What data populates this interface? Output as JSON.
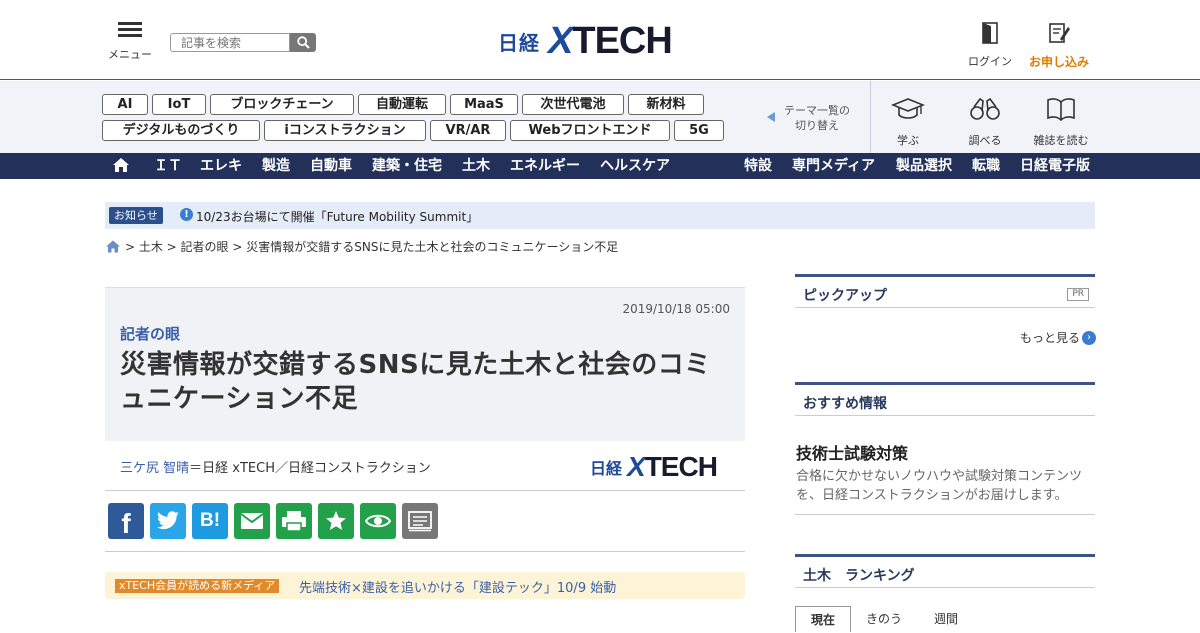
{
  "header": {
    "menu_label": "メニュー",
    "search_placeholder": "記事を検索",
    "logo_nikkei": "日経",
    "logo_xtech_x": "X",
    "logo_xtech_rest": "TECH",
    "login_label": "ログイン",
    "subscribe_label": "お申し込み"
  },
  "themes": {
    "tags": [
      "AI",
      "IoT",
      "ブロックチェーン",
      "自動運転",
      "MaaS",
      "次世代電池",
      "新材料",
      "デジタルものづくり",
      "iコンストラクション",
      "VR/AR",
      "Webフロントエンド",
      "5G"
    ],
    "switch_line1": "テーマ一覧の",
    "switch_line2": "切り替え"
  },
  "tools": {
    "learn": "学ぶ",
    "research": "調べる",
    "read": "雑誌を読む"
  },
  "catnav": {
    "left": [
      "ＩＴ",
      "エレキ",
      "製造",
      "自動車",
      "建築・住宅",
      "土木",
      "エネルギー",
      "ヘルスケア"
    ],
    "right": [
      "特設",
      "専門メディア",
      "製品選択",
      "転職",
      "日経電子版"
    ]
  },
  "notice": {
    "badge": "お知らせ",
    "icon": "!",
    "text": "10/23お台場にて開催「Future Mobility Summit」"
  },
  "breadcrumb": "> 土木 > 記者の眼 > 災害情報が交錯するSNSに見た土木と社会のコミュニケーション不足",
  "article": {
    "date": "2019/10/18 05:00",
    "category": "記者の眼",
    "title": "災害情報が交錯するSNSに見た土木と社会のコミュニケーション不足",
    "author_name": "三ケ尻 智晴",
    "author_dept": "＝日経 xTECH／日経コンストラクション"
  },
  "share": {
    "facebook_letter": "f",
    "hatena_text": "B!",
    "colors": {
      "facebook": "#2f5a9a",
      "twitter": "#2aa5e8",
      "hatena": "#1e9be0",
      "mail": "#22a04a",
      "print": "#22a04a",
      "bookmark": "#22a04a",
      "watch": "#22a04a",
      "memo": "#777777"
    }
  },
  "promo": {
    "badge": "xTECH会員が読める新メディア",
    "text": "先端技術×建設を追いかける「建設テック」10/9 始動"
  },
  "sidebar": {
    "pickup_title": "ピックアップ",
    "pr_label": "PR",
    "more_label": "もっと見る",
    "recommend_title": "おすすめ情報",
    "rec_item_title": "技術士試験対策",
    "rec_item_desc": "合格に欠かせないノウハウや試験対策コンテンツを、日経コンストラクションがお届けします。",
    "ranking_title": "土木　ランキング",
    "ranking_tabs": [
      "現在",
      "きのう",
      "週間"
    ]
  }
}
